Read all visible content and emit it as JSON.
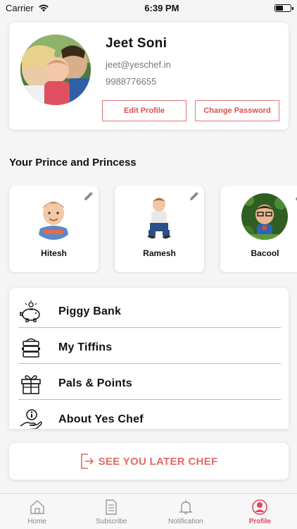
{
  "status_bar": {
    "carrier": "Carrier",
    "time": "6:39 PM",
    "battery_level": 0.45
  },
  "profile": {
    "name": "Jeet Soni",
    "email": "jeet@yeschef.in",
    "phone": "9988776655",
    "edit_label": "Edit Profile",
    "change_password_label": "Change Password"
  },
  "kids_section": {
    "title": "Your Prince and Princess",
    "kids": [
      {
        "name": "Hitesh"
      },
      {
        "name": "Ramesh"
      },
      {
        "name": "Bacool"
      }
    ]
  },
  "menu": {
    "items": [
      {
        "label": "Piggy Bank",
        "icon": "piggy-bank-icon"
      },
      {
        "label": "My Tiffins",
        "icon": "tiffin-icon"
      },
      {
        "label": "Pals & Points",
        "icon": "gift-icon"
      },
      {
        "label": "About Yes Chef",
        "icon": "info-hand-icon"
      }
    ]
  },
  "logout": {
    "label": "SEE YOU LATER CHEF",
    "icon": "logout-icon"
  },
  "tab_bar": {
    "active_color": "#e0465a",
    "tabs": [
      {
        "label": "Home",
        "icon": "home-icon"
      },
      {
        "label": "Subscribe",
        "icon": "document-icon"
      },
      {
        "label": "Notification",
        "icon": "bell-icon"
      },
      {
        "label": "Profile",
        "icon": "profile-icon"
      }
    ]
  }
}
